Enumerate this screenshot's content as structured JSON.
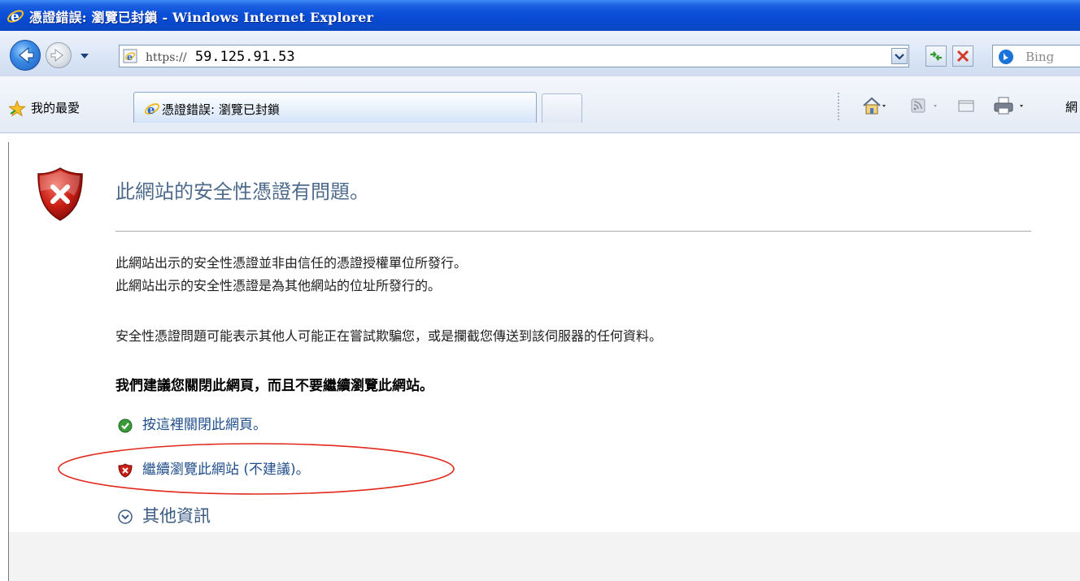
{
  "window": {
    "title": "憑證錯誤: 瀏覽已封鎖 - Windows Internet Explorer"
  },
  "nav": {
    "address_scheme": "https://",
    "address_host": "59.125.91.53",
    "search_placeholder": "Bing"
  },
  "favorites": {
    "label": "我的最愛"
  },
  "tab": {
    "title": "憑證錯誤: 瀏覽已封鎖"
  },
  "toolbar": {
    "more_label": "網"
  },
  "page": {
    "heading": "此網站的安全性憑證有問題。",
    "para1_line1": "此網站出示的安全性憑證並非由信任的憑證授權單位所發行。",
    "para1_line2": "此網站出示的安全性憑證是為其他網站的位址所發行的。",
    "para2": "安全性憑證問題可能表示其他人可能正在嘗試欺騙您，或是攔截您傳送到該伺服器的任何資料。",
    "recommendation": "我們建議您關閉此網頁，而且不要繼續瀏覽此網站。",
    "close_link": "按這裡關閉此網頁。",
    "continue_link": "繼續瀏覽此網站 (不建議)。",
    "more_info": "其他資訊"
  },
  "colors": {
    "title_bar": "#0a4fd9",
    "heading_text": "#4e6b8c",
    "link_text": "#1f4e8a",
    "annotation_ellipse": "#e0281c"
  }
}
